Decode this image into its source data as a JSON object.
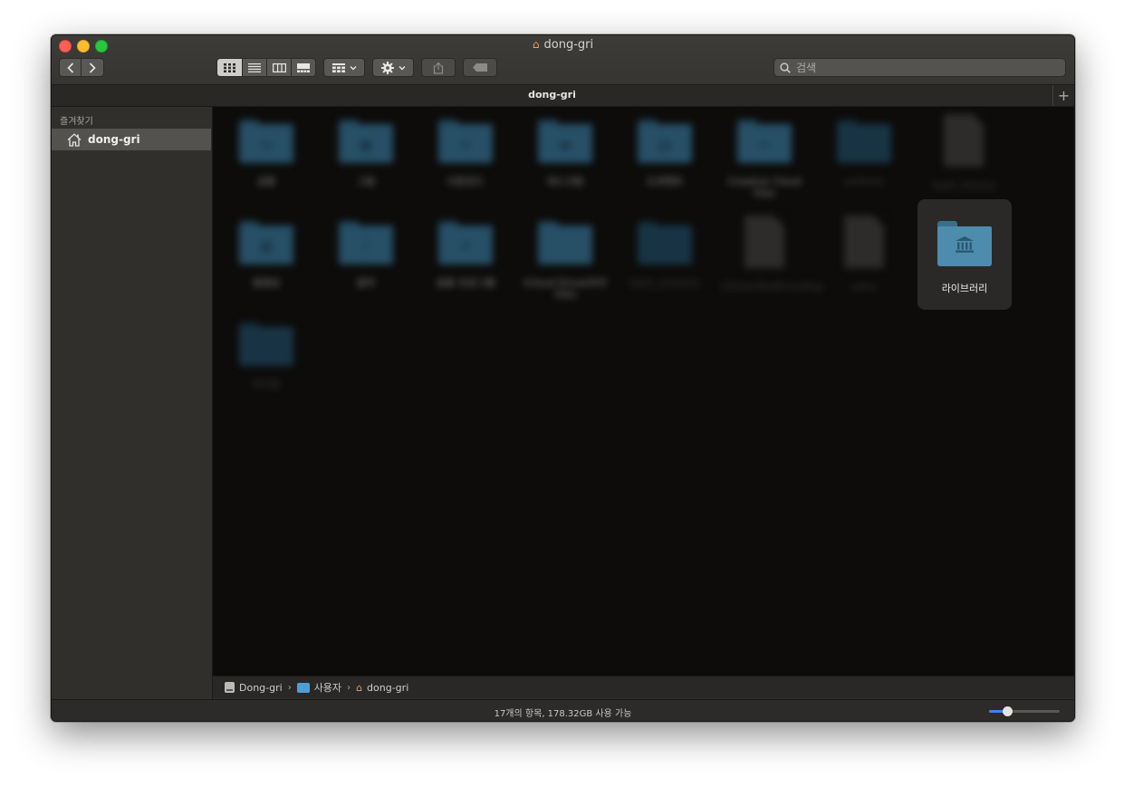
{
  "window": {
    "title": "dong-gri",
    "title_icon": "home-icon"
  },
  "toolbar": {
    "back_icon": "chevron-left-icon",
    "forward_icon": "chevron-right-icon",
    "view_modes": [
      "icon-view-icon",
      "list-view-icon",
      "column-view-icon",
      "gallery-view-icon"
    ],
    "selected_view": "icon-view-icon",
    "group_icon": "group-by-icon",
    "action_icon": "gear-icon",
    "share_icon": "share-icon",
    "tag_icon": "tag-icon",
    "search_placeholder": "검색"
  },
  "tab": {
    "label": "dong-gri",
    "add_icon": "plus-icon"
  },
  "sidebar": {
    "header": "즐겨찾기",
    "items": [
      {
        "label": "dong-gri",
        "icon": "home-icon",
        "selected": true
      }
    ]
  },
  "files": [
    {
      "name": "공용",
      "kind": "folder",
      "glyph": "◎",
      "dim": false
    },
    {
      "name": "그림",
      "kind": "folder",
      "glyph": "▣",
      "dim": false
    },
    {
      "name": "다운로드",
      "kind": "folder",
      "glyph": "⊙",
      "dim": false
    },
    {
      "name": "데스크탑",
      "kind": "folder",
      "glyph": "▬",
      "dim": false
    },
    {
      "name": "도큐멘트",
      "kind": "folder",
      "glyph": "▤",
      "dim": false
    },
    {
      "name": "Creative Cloud Files",
      "kind": "folder",
      "glyph": "∞",
      "dim": false
    },
    {
      "name": "android",
      "kind": "folder",
      "glyph": "",
      "dim": true
    },
    {
      "name": "bash_history",
      "kind": "document",
      "dim": true
    },
    {
      "name": "동영상",
      "kind": "folder",
      "glyph": "▦",
      "dim": false
    },
    {
      "name": "음악",
      "kind": "folder",
      "glyph": "♪",
      "dim": false
    },
    {
      "name": "응용 프로그램",
      "kind": "folder",
      "glyph": "✕",
      "dim": false
    },
    {
      "name": "iCloud Drive(아카이브)",
      "kind": "folder",
      "glyph": "",
      "dim": false
    },
    {
      "name": "bash_sessions",
      "kind": "folder",
      "glyph": "",
      "dim": true
    },
    {
      "name": "CFUserTextEncoding",
      "kind": "document",
      "dim": true
    },
    {
      "name": "zshrc",
      "kind": "document",
      "dim": true
    },
    {
      "name": "라이브러리",
      "kind": "folder",
      "glyph": "🏛",
      "dim": false,
      "selected": true
    },
    {
      "name": "하이렌",
      "kind": "folder",
      "glyph": "",
      "dim": false
    }
  ],
  "pathbar": {
    "crumbs": [
      {
        "label": "Dong-gri",
        "icon": "disk-icon"
      },
      {
        "label": "사용자",
        "icon": "users-folder-icon"
      },
      {
        "label": "dong-gri",
        "icon": "home-icon"
      }
    ]
  },
  "status": {
    "text": "17개의 항목, 178.32GB 사용 가능",
    "icon_size_fraction": 0.25
  }
}
